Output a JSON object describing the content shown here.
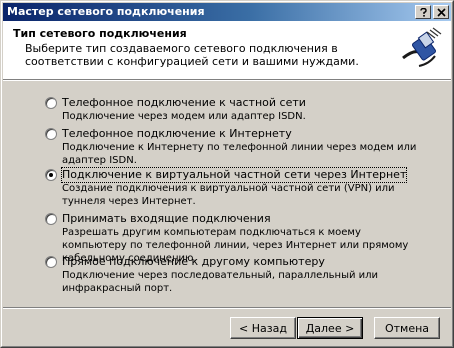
{
  "window": {
    "title": "Мастер сетевого подключения"
  },
  "header": {
    "title": "Тип сетевого подключения",
    "description": "Выберите тип создаваемого сетевого подключения в соответствии с конфигурацией сети и вашими нуждами.",
    "icon": "network-cable-icon"
  },
  "options": [
    {
      "label": "Телефонное подключение к частной сети",
      "description": "Подключение через модем или адаптер ISDN.",
      "checked": false
    },
    {
      "label": "Телефонное подключение к Интернету",
      "description": "Подключение к Интернету по телефонной линии через модем или адаптер ISDN.",
      "checked": false
    },
    {
      "label": "Подключение к виртуальной частной сети через Интернет",
      "description": "Создание подключения к виртуальной частной сети (VPN) или туннеля через Интернет.",
      "checked": true
    },
    {
      "label": "Принимать входящие подключения",
      "description": "Разрешать другим компьютерам подключаться к моему компьютеру по телефонной линии, через Интернет или прямому кабельному соединению.",
      "checked": false
    },
    {
      "label": "Прямое подключение к другому компьютеру",
      "description": "Подключение через последовательный, параллельный или инфракрасный порт.",
      "checked": false
    }
  ],
  "buttons": {
    "back": "< Назад",
    "next": "Далее >",
    "cancel": "Отмена"
  }
}
